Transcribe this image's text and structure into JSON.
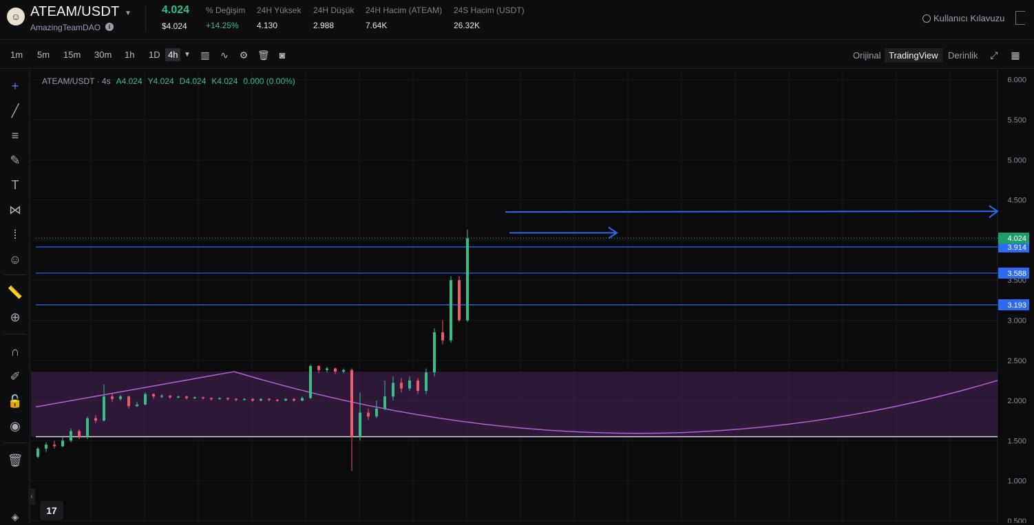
{
  "header": {
    "pair": "ATEAM/USDT",
    "project": "AmazingTeamDAO",
    "price": "4.024",
    "price_usd": "$4.024",
    "stats": [
      {
        "label": "% Değişim",
        "value": "+14.25%",
        "positive": true
      },
      {
        "label": "24H Yüksek",
        "value": "4.130"
      },
      {
        "label": "24H Düşük",
        "value": "2.988"
      },
      {
        "label": "24H Hacim (ATEAM)",
        "value": "7.64K"
      },
      {
        "label": "24S Hacim (USDT)",
        "value": "26.32K"
      }
    ],
    "guide": "Kullanıcı Kılavuzu"
  },
  "toolbar": {
    "timeframes": [
      "1m",
      "5m",
      "15m",
      "30m",
      "1h",
      "1D",
      "4h"
    ],
    "active_timeframe": "4h",
    "views": [
      "Orijinal",
      "TradingView",
      "Derinlik"
    ],
    "active_view": "TradingView"
  },
  "legend": {
    "symbol": "ATEAM/USDT · 4s",
    "open": "A4.024",
    "high": "Y4.024",
    "low": "D4.024",
    "close": "K4.024",
    "change": "0.000 (0.00%)"
  },
  "chart_data": {
    "type": "candlestick",
    "ylim": [
      0.5,
      6.1
    ],
    "y_ticks": [
      "6.000",
      "5.500",
      "5.000",
      "4.500",
      "4.000",
      "3.500",
      "3.000",
      "2.500",
      "2.000",
      "1.500",
      "1.000",
      "0.500"
    ],
    "last_price": "4.024",
    "horizontal_levels": [
      "3.914",
      "3.588",
      "3.193"
    ],
    "support_line": 1.55,
    "colors": {
      "up": "#35c08a",
      "down": "#f05a6b",
      "level": "#2f6bf0",
      "zone": "#3a1f45",
      "arc": "#b063d8"
    },
    "candles": [
      [
        1.3,
        1.4,
        1.28,
        1.42
      ],
      [
        1.4,
        1.45,
        1.36,
        1.48
      ],
      [
        1.45,
        1.43,
        1.4,
        1.5
      ],
      [
        1.43,
        1.5,
        1.42,
        1.55
      ],
      [
        1.5,
        1.62,
        1.48,
        1.65
      ],
      [
        1.62,
        1.55,
        1.52,
        1.64
      ],
      [
        1.55,
        1.78,
        1.52,
        1.8
      ],
      [
        1.78,
        1.75,
        1.72,
        1.82
      ],
      [
        1.75,
        2.05,
        1.74,
        2.2
      ],
      [
        2.05,
        2.02,
        1.98,
        2.08
      ],
      [
        2.02,
        2.05,
        2.0,
        2.07
      ],
      [
        2.05,
        1.93,
        1.9,
        2.06
      ],
      [
        1.93,
        1.95,
        1.92,
        1.98
      ],
      [
        1.95,
        2.08,
        1.94,
        2.1
      ],
      [
        2.08,
        2.05,
        2.02,
        2.09
      ],
      [
        2.05,
        2.06,
        2.03,
        2.08
      ],
      [
        2.06,
        2.04,
        2.02,
        2.07
      ],
      [
        2.04,
        2.05,
        2.03,
        2.06
      ],
      [
        2.05,
        2.03,
        2.01,
        2.06
      ],
      [
        2.03,
        2.04,
        2.02,
        2.05
      ],
      [
        2.04,
        2.03,
        2.01,
        2.05
      ],
      [
        2.03,
        2.02,
        2.0,
        2.04
      ],
      [
        2.02,
        2.03,
        2.01,
        2.04
      ],
      [
        2.03,
        2.02,
        2.0,
        2.04
      ],
      [
        2.02,
        2.01,
        1.99,
        2.03
      ],
      [
        2.01,
        2.02,
        2.0,
        2.03
      ],
      [
        2.02,
        2.0,
        1.98,
        2.03
      ],
      [
        2.0,
        2.02,
        1.99,
        2.03
      ],
      [
        2.02,
        2.01,
        1.99,
        2.03
      ],
      [
        2.01,
        2.0,
        1.98,
        2.02
      ],
      [
        2.0,
        2.02,
        1.99,
        2.03
      ],
      [
        2.02,
        2.0,
        1.98,
        2.03
      ],
      [
        2.0,
        2.03,
        1.99,
        2.05
      ],
      [
        2.03,
        2.43,
        2.02,
        2.45
      ],
      [
        2.43,
        2.38,
        2.34,
        2.44
      ],
      [
        2.38,
        2.4,
        2.35,
        2.42
      ],
      [
        2.4,
        2.36,
        2.33,
        2.41
      ],
      [
        2.36,
        2.38,
        2.34,
        2.4
      ],
      [
        2.38,
        1.55,
        1.12,
        2.4
      ],
      [
        1.55,
        1.85,
        1.5,
        2.1
      ],
      [
        1.85,
        1.8,
        1.76,
        1.9
      ],
      [
        1.8,
        1.9,
        1.78,
        2.0
      ],
      [
        1.9,
        2.05,
        1.88,
        2.25
      ],
      [
        2.05,
        2.22,
        2.0,
        2.3
      ],
      [
        2.22,
        2.15,
        2.1,
        2.28
      ],
      [
        2.15,
        2.25,
        2.12,
        2.3
      ],
      [
        2.25,
        2.12,
        2.08,
        2.28
      ],
      [
        2.12,
        2.35,
        2.08,
        2.4
      ],
      [
        2.35,
        2.85,
        2.3,
        2.9
      ],
      [
        2.85,
        2.75,
        2.7,
        3.0
      ],
      [
        2.75,
        3.5,
        2.72,
        3.55
      ],
      [
        3.5,
        3.0,
        2.98,
        3.55
      ],
      [
        3.0,
        4.02,
        2.98,
        4.13
      ]
    ]
  },
  "icons": [
    "crosshair-icon",
    "trend-line-icon",
    "fib-icon",
    "brush-icon",
    "text-icon",
    "pattern-icon",
    "measure-icon",
    "emoji-icon",
    "ruler-icon",
    "zoom-icon",
    "magnet-icon",
    "lock-draw-icon",
    "lock-icon",
    "eye-icon",
    "trash-icon"
  ]
}
